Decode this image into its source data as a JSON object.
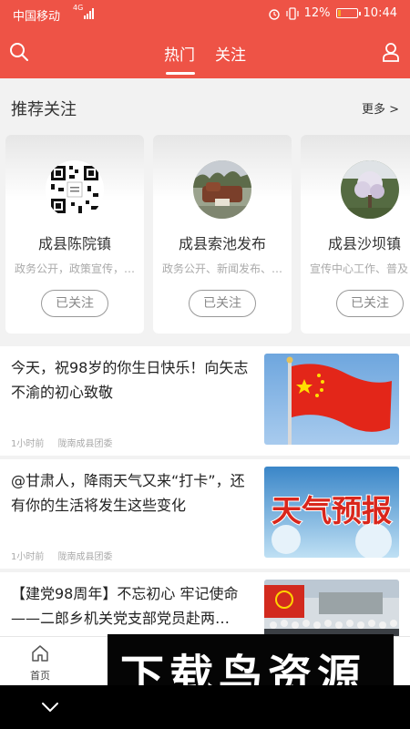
{
  "status_bar": {
    "carrier": "中国移动",
    "network": "4G",
    "battery": "12%",
    "time": "10:44"
  },
  "header": {
    "tabs": [
      "热门",
      "关注"
    ]
  },
  "recommend": {
    "title": "推荐关注",
    "more": "更多 >",
    "cards": [
      {
        "name": "成县陈院镇",
        "desc": "政务公开，政策宣传，…",
        "button": "已关注"
      },
      {
        "name": "成县索池发布",
        "desc": "政务公开、新闻发布、…",
        "button": "已关注"
      },
      {
        "name": "成县沙坝镇",
        "desc": "宣传中心工作、普及",
        "button": "已关注"
      }
    ]
  },
  "news": [
    {
      "headline": "今天，祝98岁的你生日快乐！向矢志不渝的初心致敬",
      "time": "1小时前",
      "source": "陇南成县团委"
    },
    {
      "headline": "@甘肃人，降雨天气又来“打卡”，还有你的生活将发生这些变化",
      "time": "1小时前",
      "source": "陇南成县团委",
      "image_text": "天气预报"
    },
    {
      "headline": "【建党98周年】不忘初心 牢记使命——二郎乡机关党支部党员赴两…"
    }
  ],
  "bottom_nav": {
    "home_label": "首页"
  },
  "watermark": {
    "text": "下载鸟资源"
  },
  "colors": {
    "brand_red": "#ee5346"
  }
}
